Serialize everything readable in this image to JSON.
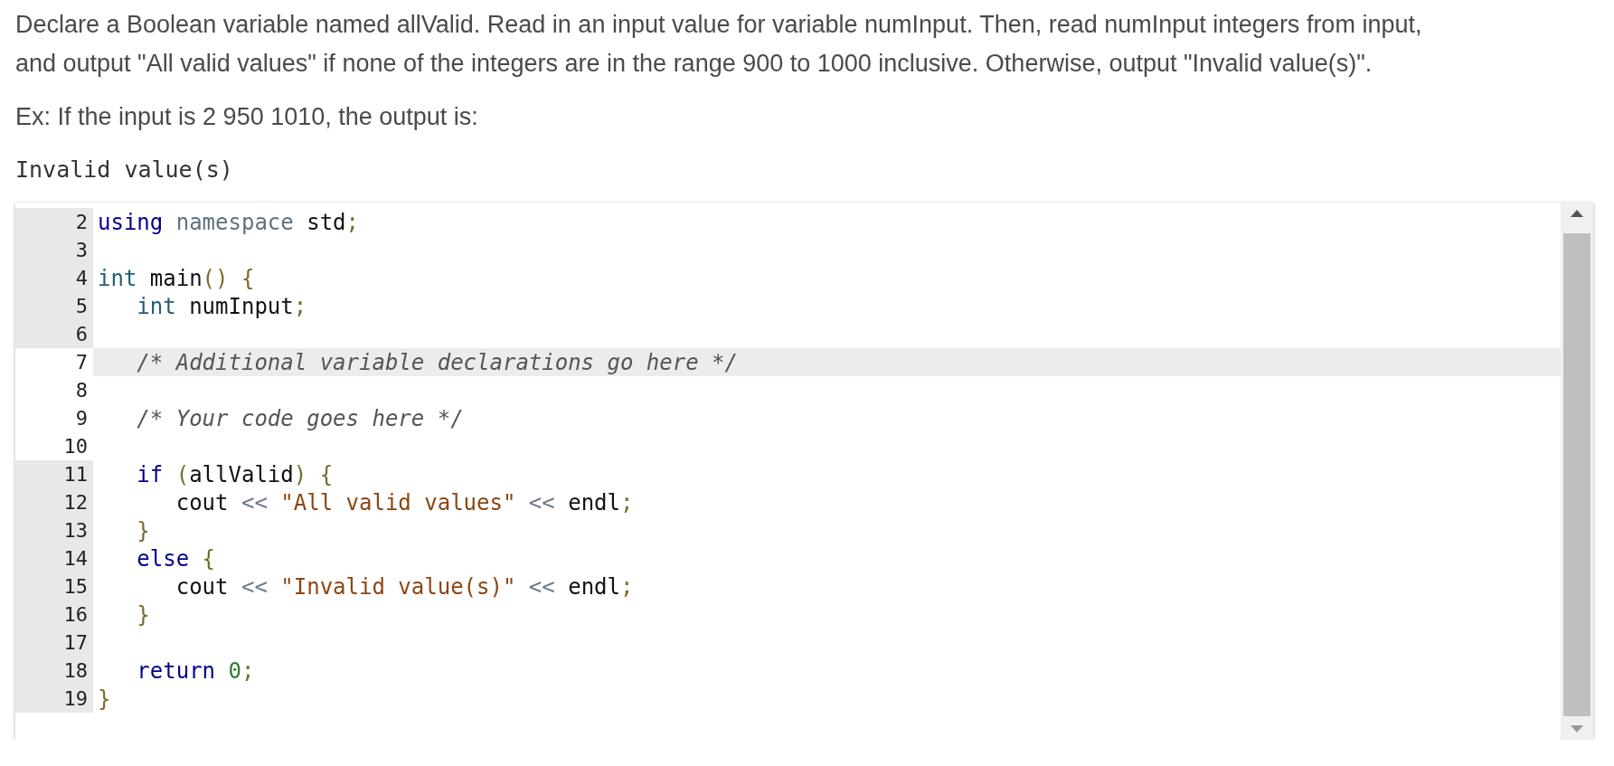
{
  "prompt": {
    "paragraphs": [
      "Declare a Boolean variable named allValid. Read in an input value for variable numInput. Then, read numInput integers from input, and output \"All valid values\" if none of the integers are in the range 900 to 1000 inclusive. Otherwise, output \"Invalid value(s)\".",
      "Ex: If the input is 2 950 1010, the output is:"
    ],
    "sample_output": "Invalid value(s)"
  },
  "editor": {
    "lines": [
      {
        "number": "2",
        "readonly": true,
        "active": false,
        "tokens": [
          {
            "kind": "keyword",
            "text": "using "
          },
          {
            "kind": "muted",
            "text": "namespace "
          },
          {
            "kind": "plain",
            "text": "std"
          },
          {
            "kind": "punct",
            "text": ";"
          }
        ]
      },
      {
        "number": "3",
        "readonly": true,
        "active": false
      },
      {
        "number": "4",
        "readonly": true,
        "active": false,
        "tokens": [
          {
            "kind": "type",
            "text": "int "
          },
          {
            "kind": "plain",
            "text": "main"
          },
          {
            "kind": "punct",
            "text": "() {"
          }
        ]
      },
      {
        "number": "5",
        "readonly": true,
        "active": false,
        "tokens": [
          {
            "kind": "type",
            "text": "   int "
          },
          {
            "kind": "plain",
            "text": "numInput"
          },
          {
            "kind": "punct",
            "text": ";"
          }
        ]
      },
      {
        "number": "6",
        "readonly": true,
        "active": false
      },
      {
        "number": "7",
        "readonly": false,
        "active": true,
        "tokens": [
          {
            "kind": "comment",
            "text": "   /* Additional variable declarations go here */"
          }
        ]
      },
      {
        "number": "8",
        "readonly": false,
        "active": false
      },
      {
        "number": "9",
        "readonly": false,
        "active": false,
        "tokens": [
          {
            "kind": "comment",
            "text": "   /* Your code goes here */"
          }
        ]
      },
      {
        "number": "10",
        "readonly": false,
        "active": false
      },
      {
        "number": "11",
        "readonly": true,
        "active": false,
        "tokens": [
          {
            "kind": "keyword",
            "text": "   if "
          },
          {
            "kind": "punct",
            "text": "("
          },
          {
            "kind": "plain",
            "text": "allValid"
          },
          {
            "kind": "punct",
            "text": ") {"
          }
        ]
      },
      {
        "number": "12",
        "readonly": true,
        "active": false,
        "tokens": [
          {
            "kind": "plain",
            "text": "      cout "
          },
          {
            "kind": "operator",
            "text": "<< "
          },
          {
            "kind": "string",
            "text": "\"All valid values\" "
          },
          {
            "kind": "operator",
            "text": "<< "
          },
          {
            "kind": "plain",
            "text": "endl"
          },
          {
            "kind": "punct",
            "text": ";"
          }
        ]
      },
      {
        "number": "13",
        "readonly": true,
        "active": false,
        "tokens": [
          {
            "kind": "punct",
            "text": "   }"
          }
        ]
      },
      {
        "number": "14",
        "readonly": true,
        "active": false,
        "tokens": [
          {
            "kind": "keyword",
            "text": "   else "
          },
          {
            "kind": "punct",
            "text": "{"
          }
        ]
      },
      {
        "number": "15",
        "readonly": true,
        "active": false,
        "tokens": [
          {
            "kind": "plain",
            "text": "      cout "
          },
          {
            "kind": "operator",
            "text": "<< "
          },
          {
            "kind": "string",
            "text": "\"Invalid value(s)\" "
          },
          {
            "kind": "operator",
            "text": "<< "
          },
          {
            "kind": "plain",
            "text": "endl"
          },
          {
            "kind": "punct",
            "text": ";"
          }
        ]
      },
      {
        "number": "16",
        "readonly": true,
        "active": false,
        "tokens": [
          {
            "kind": "punct",
            "text": "   }"
          }
        ]
      },
      {
        "number": "17",
        "readonly": true,
        "active": false
      },
      {
        "number": "18",
        "readonly": true,
        "active": false,
        "tokens": [
          {
            "kind": "keyword",
            "text": "   return "
          },
          {
            "kind": "number",
            "text": "0"
          },
          {
            "kind": "punct",
            "text": ";"
          }
        ]
      },
      {
        "number": "19",
        "readonly": true,
        "active": false,
        "tokens": [
          {
            "kind": "punct",
            "text": "}"
          }
        ]
      }
    ]
  }
}
